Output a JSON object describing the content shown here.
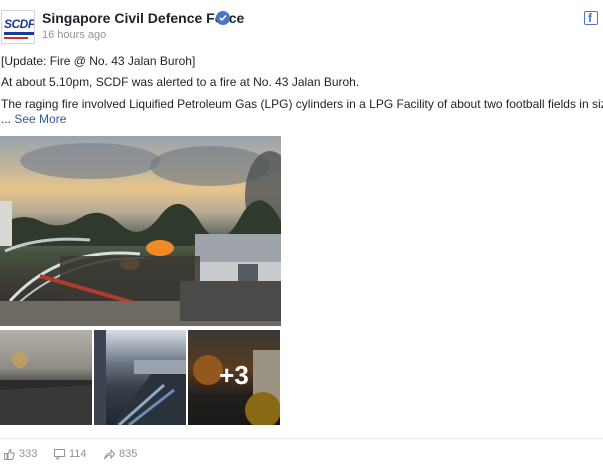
{
  "header": {
    "page_name": "Singapore Civil Defence Force",
    "timestamp": "16 hours ago",
    "avatar_text": "SCDF"
  },
  "post": {
    "line1": "[Update: Fire @ No. 43 Jalan Buroh]",
    "line2": "At about 5.10pm, SCDF was alerted to a fire at No. 43 Jalan Buroh.",
    "line3": "The raging fire involved Liquified Petroleum Gas (LPG) cylinders in a LPG Facility of about two football fields in size.",
    "ellipsis": "...",
    "see_more": "See More"
  },
  "photos": {
    "more_count": "+3"
  },
  "footer": {
    "likes": "333",
    "comments": "114",
    "shares": "835"
  },
  "colors": {
    "link": "#365899",
    "verified": "#4a76c6",
    "meta": "#90949c"
  }
}
